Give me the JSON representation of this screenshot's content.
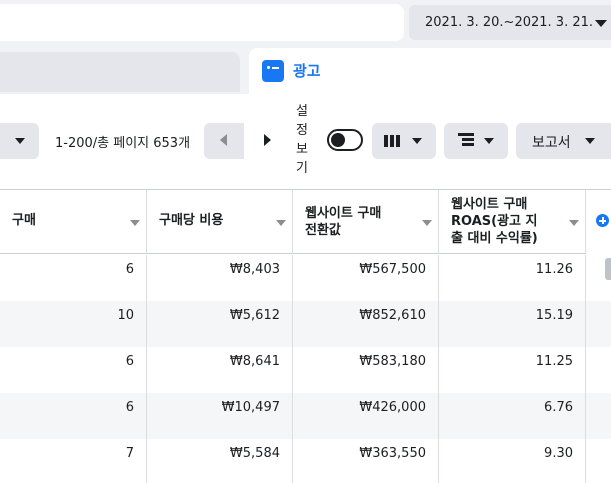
{
  "date_range": {
    "label": "2021. 3. 20.~2021. 3. 21."
  },
  "tab": {
    "label": "광고"
  },
  "toolbar": {
    "pager_text": "1-200/총 페이지 653개",
    "breakdown_label_chars": [
      "설",
      "정",
      "보",
      "기"
    ],
    "report_label": "보고서"
  },
  "table": {
    "headers": [
      {
        "line1": "구매",
        "line2": "",
        "line3": ""
      },
      {
        "line1": "구매당 비용",
        "line2": "",
        "line3": ""
      },
      {
        "line1": "웹사이트 구매",
        "line2": "전환값",
        "line3": ""
      },
      {
        "line1": "웹사이트 구매",
        "line2": "ROAS(광고 지",
        "line3": "출 대비 수익률)"
      }
    ],
    "rows": [
      [
        "6",
        "₩8,403",
        "₩567,500",
        "11.26"
      ],
      [
        "10",
        "₩5,612",
        "₩852,610",
        "15.19"
      ],
      [
        "6",
        "₩8,641",
        "₩583,180",
        "11.25"
      ],
      [
        "6",
        "₩10,497",
        "₩426,000",
        "6.76"
      ],
      [
        "7",
        "₩5,584",
        "₩363,550",
        "9.30"
      ]
    ]
  }
}
